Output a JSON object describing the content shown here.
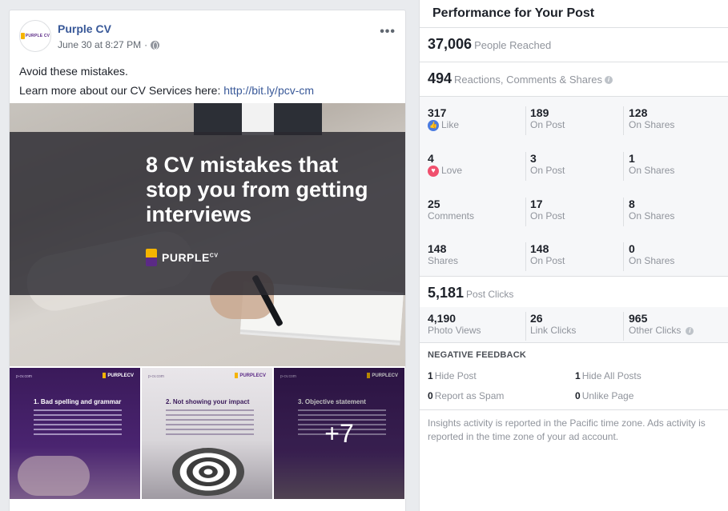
{
  "post": {
    "page_name": "Purple CV",
    "avatar_text": "PURPLE CV",
    "date": "June 30 at 8:27 PM",
    "dot": "·",
    "more": "•••",
    "text_line1": "Avoid these mistakes.",
    "text_line2_prefix": "Learn more about our CV Services here: ",
    "link": "http://bit.ly/pcv-cm",
    "hero": {
      "title": "8 CV mistakes that stop you from getting interviews",
      "brand": "PURPLE",
      "brand_sup": "CV"
    },
    "thumbs": [
      {
        "site": "p-cv.com",
        "logo": "PURPLECV",
        "heading": "1. Bad spelling and grammar"
      },
      {
        "site": "p-cv.com",
        "logo": "PURPLECV",
        "heading": "2. Not showing your impact"
      },
      {
        "site": "p-cv.com",
        "logo": "PURPLECV",
        "heading": "3. Objective statement"
      }
    ],
    "more_count": "+7"
  },
  "insights": {
    "title": "Performance for Your Post",
    "reached": {
      "value": "37,006",
      "label": "People Reached"
    },
    "engagement": {
      "value": "494",
      "label": "Reactions, Comments & Shares"
    },
    "rows": [
      {
        "total": "317",
        "label": "Like",
        "on_post": "189",
        "on_post_label": "On Post",
        "on_shares": "128",
        "on_shares_label": "On Shares"
      },
      {
        "total": "4",
        "label": "Love",
        "on_post": "3",
        "on_post_label": "On Post",
        "on_shares": "1",
        "on_shares_label": "On Shares"
      },
      {
        "total": "25",
        "label": "Comments",
        "on_post": "17",
        "on_post_label": "On Post",
        "on_shares": "8",
        "on_shares_label": "On Shares"
      },
      {
        "total": "148",
        "label": "Shares",
        "on_post": "148",
        "on_post_label": "On Post",
        "on_shares": "0",
        "on_shares_label": "On Shares"
      }
    ],
    "clicks": {
      "value": "5,181",
      "label": "Post Clicks"
    },
    "click_breakdown": [
      {
        "value": "4,190",
        "label": "Photo Views"
      },
      {
        "value": "26",
        "label": "Link Clicks"
      },
      {
        "value": "965",
        "label": "Other Clicks"
      }
    ],
    "negative": {
      "heading": "NEGATIVE FEEDBACK",
      "hide_post": {
        "value": "1",
        "label": "Hide Post"
      },
      "hide_all": {
        "value": "1",
        "label": "Hide All Posts"
      },
      "spam": {
        "value": "0",
        "label": "Report as Spam"
      },
      "unlike": {
        "value": "0",
        "label": "Unlike Page"
      }
    },
    "footnote": "Insights activity is reported in the Pacific time zone. Ads activity is reported in the time zone of your ad account.",
    "info_glyph": "i"
  }
}
